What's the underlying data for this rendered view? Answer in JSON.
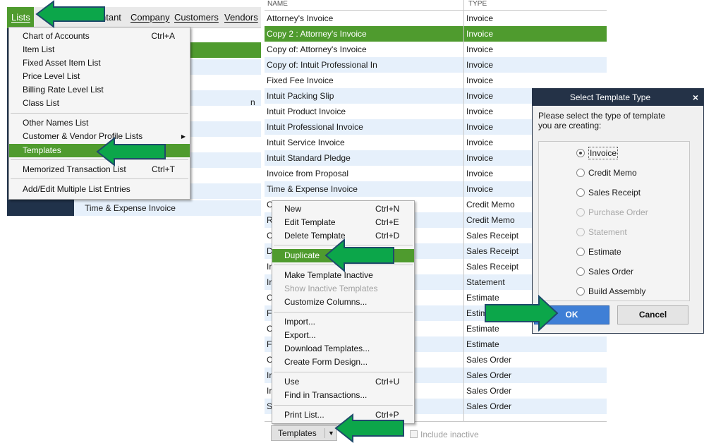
{
  "menubar": {
    "lists": "Lists",
    "accountant": "ntant",
    "company": "Company",
    "customers": "Customers",
    "vendors": "Vendors"
  },
  "lists_menu": {
    "items": [
      {
        "label": "Chart of Accounts",
        "shortcut": "Ctrl+A"
      },
      {
        "label": "Item List",
        "shortcut": ""
      },
      {
        "label": "Fixed Asset Item List",
        "shortcut": ""
      },
      {
        "label": "Price Level List",
        "shortcut": ""
      },
      {
        "label": "Billing Rate Level List",
        "shortcut": ""
      },
      {
        "label": "Class List",
        "shortcut": ""
      },
      {
        "label": "Other Names List",
        "shortcut": ""
      },
      {
        "label": "Customer & Vendor Profile Lists",
        "shortcut": ""
      },
      {
        "label": "Templates",
        "shortcut": ""
      },
      {
        "label": "Memorized Transaction List",
        "shortcut": "Ctrl+T"
      },
      {
        "label": "Add/Edit Multiple List Entries",
        "shortcut": ""
      }
    ],
    "background_partial_text": "n",
    "background_row_text": "Time & Expense Invoice"
  },
  "template_list": {
    "header_name": "NAME",
    "header_type": "TYPE",
    "rows": [
      {
        "name": "Attorney's Invoice",
        "type": "Invoice"
      },
      {
        "name": "Copy 2 : Attorney's Invoice",
        "type": "Invoice"
      },
      {
        "name": "Copy of: Attorney's Invoice",
        "type": "Invoice"
      },
      {
        "name": "Copy of: Intuit Professional In",
        "type": "Invoice"
      },
      {
        "name": "Fixed Fee Invoice",
        "type": "Invoice"
      },
      {
        "name": "Intuit Packing Slip",
        "type": "Invoice"
      },
      {
        "name": "Intuit Product Invoice",
        "type": "Invoice"
      },
      {
        "name": "Intuit Professional Invoice",
        "type": "Invoice"
      },
      {
        "name": "Intuit Service Invoice",
        "type": "Invoice"
      },
      {
        "name": "Intuit Standard Pledge",
        "type": "Invoice"
      },
      {
        "name": "Invoice from Proposal",
        "type": "Invoice"
      },
      {
        "name": "Time & Expense Invoice",
        "type": "Invoice"
      },
      {
        "name": "C",
        "type": "Credit Memo"
      },
      {
        "name": "R",
        "type": "Credit Memo"
      },
      {
        "name": "C",
        "type": "Sales Receipt"
      },
      {
        "name": "D",
        "type": "Sales Receipt"
      },
      {
        "name": "Ir",
        "type": "Sales Receipt"
      },
      {
        "name": "Ir",
        "type": "Statement"
      },
      {
        "name": "C",
        "type": "Estimate"
      },
      {
        "name": "F",
        "type": "Estim"
      },
      {
        "name": "C",
        "type": "Estimate"
      },
      {
        "name": "F",
        "type": "Estimate"
      },
      {
        "name": "C",
        "type": "Sales Order"
      },
      {
        "name": "Ir",
        "type": "Sales Order"
      },
      {
        "name": "Ir",
        "type": "Sales Order"
      },
      {
        "name": "S",
        "type": "Sales Order"
      }
    ]
  },
  "context_menu": {
    "items": [
      {
        "label": "New",
        "shortcut": "Ctrl+N"
      },
      {
        "label": "Edit Template",
        "shortcut": "Ctrl+E"
      },
      {
        "label": "Delete Template",
        "shortcut": "Ctrl+D"
      },
      {
        "label": "Duplicate",
        "shortcut": ""
      },
      {
        "label": "Make Template Inactive",
        "shortcut": ""
      },
      {
        "label": "Show Inactive Templates",
        "shortcut": ""
      },
      {
        "label": "Customize Columns...",
        "shortcut": ""
      },
      {
        "label": "Import...",
        "shortcut": ""
      },
      {
        "label": "Export...",
        "shortcut": ""
      },
      {
        "label": "Download Templates...",
        "shortcut": ""
      },
      {
        "label": "Create Form Design...",
        "shortcut": ""
      },
      {
        "label": "Use",
        "shortcut": "Ctrl+U"
      },
      {
        "label": "Find in Transactions...",
        "shortcut": ""
      },
      {
        "label": "Print List...",
        "shortcut": "Ctrl+P"
      }
    ]
  },
  "bottom_bar": {
    "templates_button": "Templates",
    "include_inactive": "Include inactive"
  },
  "dialog": {
    "title": "Select Template Type",
    "close": "×",
    "prompt": "Please select the type of template you are creating:",
    "options": [
      {
        "label": "Invoice",
        "checked": true,
        "disabled": false
      },
      {
        "label": "Credit Memo",
        "checked": false,
        "disabled": false
      },
      {
        "label": "Sales Receipt",
        "checked": false,
        "disabled": false
      },
      {
        "label": "Purchase Order",
        "checked": false,
        "disabled": true
      },
      {
        "label": "Statement",
        "checked": false,
        "disabled": true
      },
      {
        "label": "Estimate",
        "checked": false,
        "disabled": false
      },
      {
        "label": "Sales Order",
        "checked": false,
        "disabled": false
      },
      {
        "label": "Build Assembly",
        "checked": false,
        "disabled": false
      }
    ],
    "ok": "OK",
    "cancel": "Cancel"
  },
  "colors": {
    "accent_green": "#4f9b2e",
    "annotation_arrow": "#0ca64a",
    "dialog_titlebar": "#243247",
    "ok_button": "#3f7fd6",
    "row_alt": "#e6f0fb"
  }
}
